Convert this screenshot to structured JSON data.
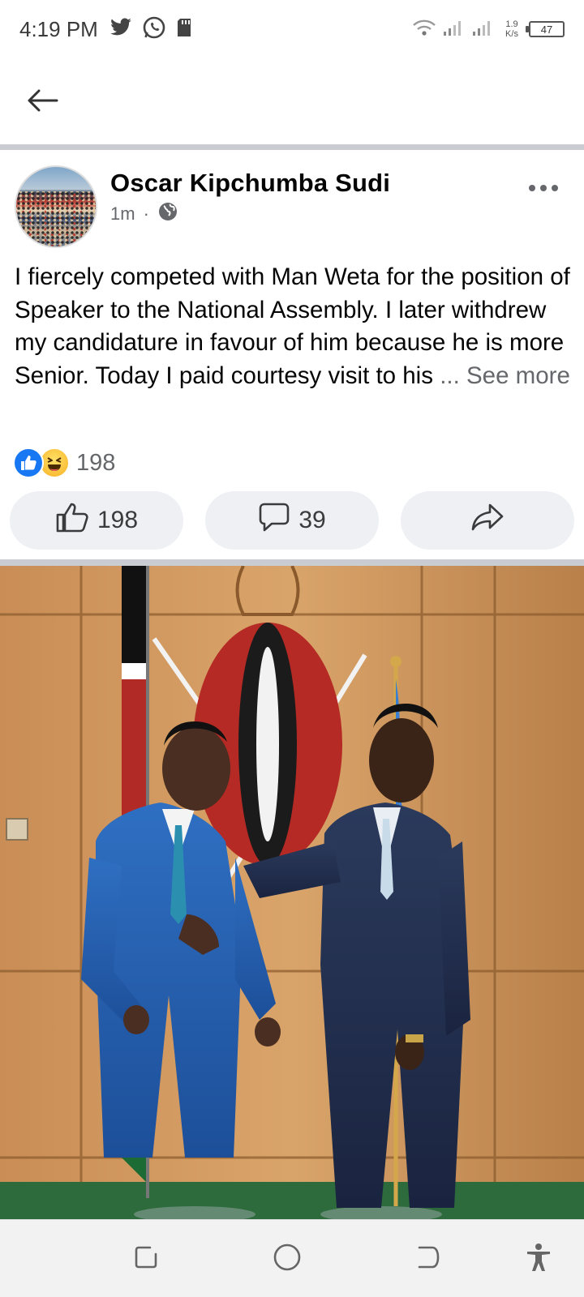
{
  "status_bar": {
    "time": "4:19 PM",
    "net_speed_value": "1.9",
    "net_speed_unit": "K/s",
    "battery": "47"
  },
  "post": {
    "author": "Oscar Kipchumba Sudi",
    "time_ago": "1m",
    "separator": "·",
    "text": "I fiercely competed with Man Weta for the position of Speaker to the National Assembly. I later withdrew my candidature in favour of him because he is more Senior. Today I paid courtesy visit to his ",
    "ellipsis": "...",
    "see_more": "See more",
    "reaction_count": "198",
    "like_count": "198",
    "comment_count": "39"
  },
  "colors": {
    "like_blue": "#1877f2",
    "muted_text": "#65676b",
    "action_bg": "#eef0f3",
    "divider": "#c9ccd1"
  },
  "icons": {
    "back": "arrow-left-icon",
    "twitter": "twitter-icon",
    "whatsapp": "whatsapp-icon",
    "sd_card": "sd-card-icon",
    "wifi": "wifi-icon",
    "signal": "signal-icon",
    "globe": "globe-icon",
    "like": "thumbs-up-icon",
    "comment": "comment-icon",
    "share": "share-icon"
  }
}
